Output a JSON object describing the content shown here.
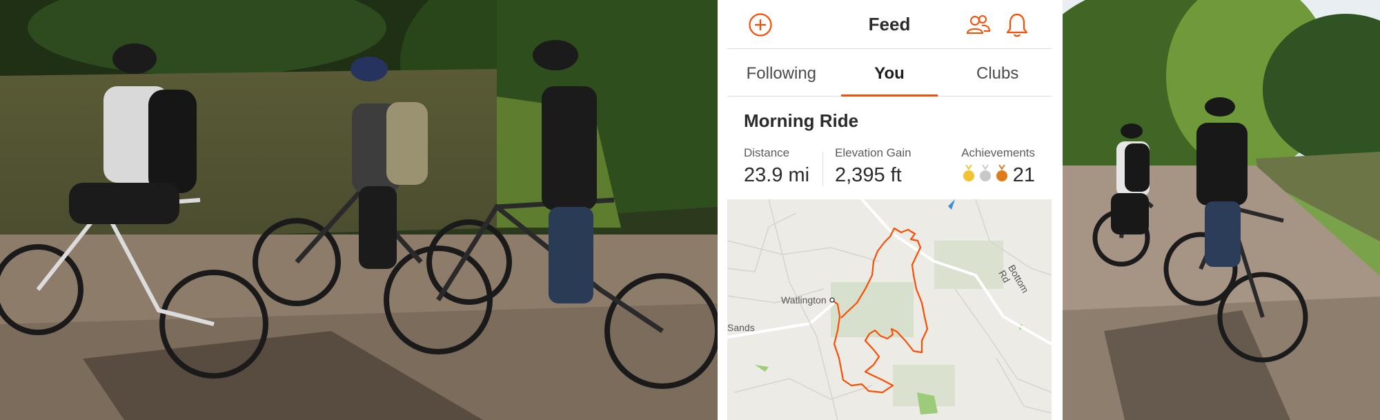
{
  "app": {
    "header": {
      "title": "Feed"
    },
    "tabs": [
      {
        "label": "Following",
        "active": false
      },
      {
        "label": "You",
        "active": true
      },
      {
        "label": "Clubs",
        "active": false
      }
    ],
    "activity": {
      "title": "Morning Ride",
      "stats": {
        "distance": {
          "label": "Distance",
          "value": "23.9 mi"
        },
        "elevation": {
          "label": "Elevation Gain",
          "value": "2,395 ft"
        },
        "achievements": {
          "label": "Achievements",
          "value": "21",
          "medals": [
            "gold-medal-icon",
            "silver-medal-icon",
            "bronze-medal-icon"
          ]
        }
      },
      "map": {
        "labels": {
          "town": "Watlington",
          "sands": "Sands",
          "road": "Bottom Rd"
        }
      }
    },
    "icons": [
      "add-circle-icon",
      "people-icon",
      "bell-icon"
    ],
    "colors": {
      "accent": "#fc4c02",
      "gold": "#f2c230",
      "silver": "#c8c8c8",
      "bronze": "#e07b1a"
    }
  }
}
